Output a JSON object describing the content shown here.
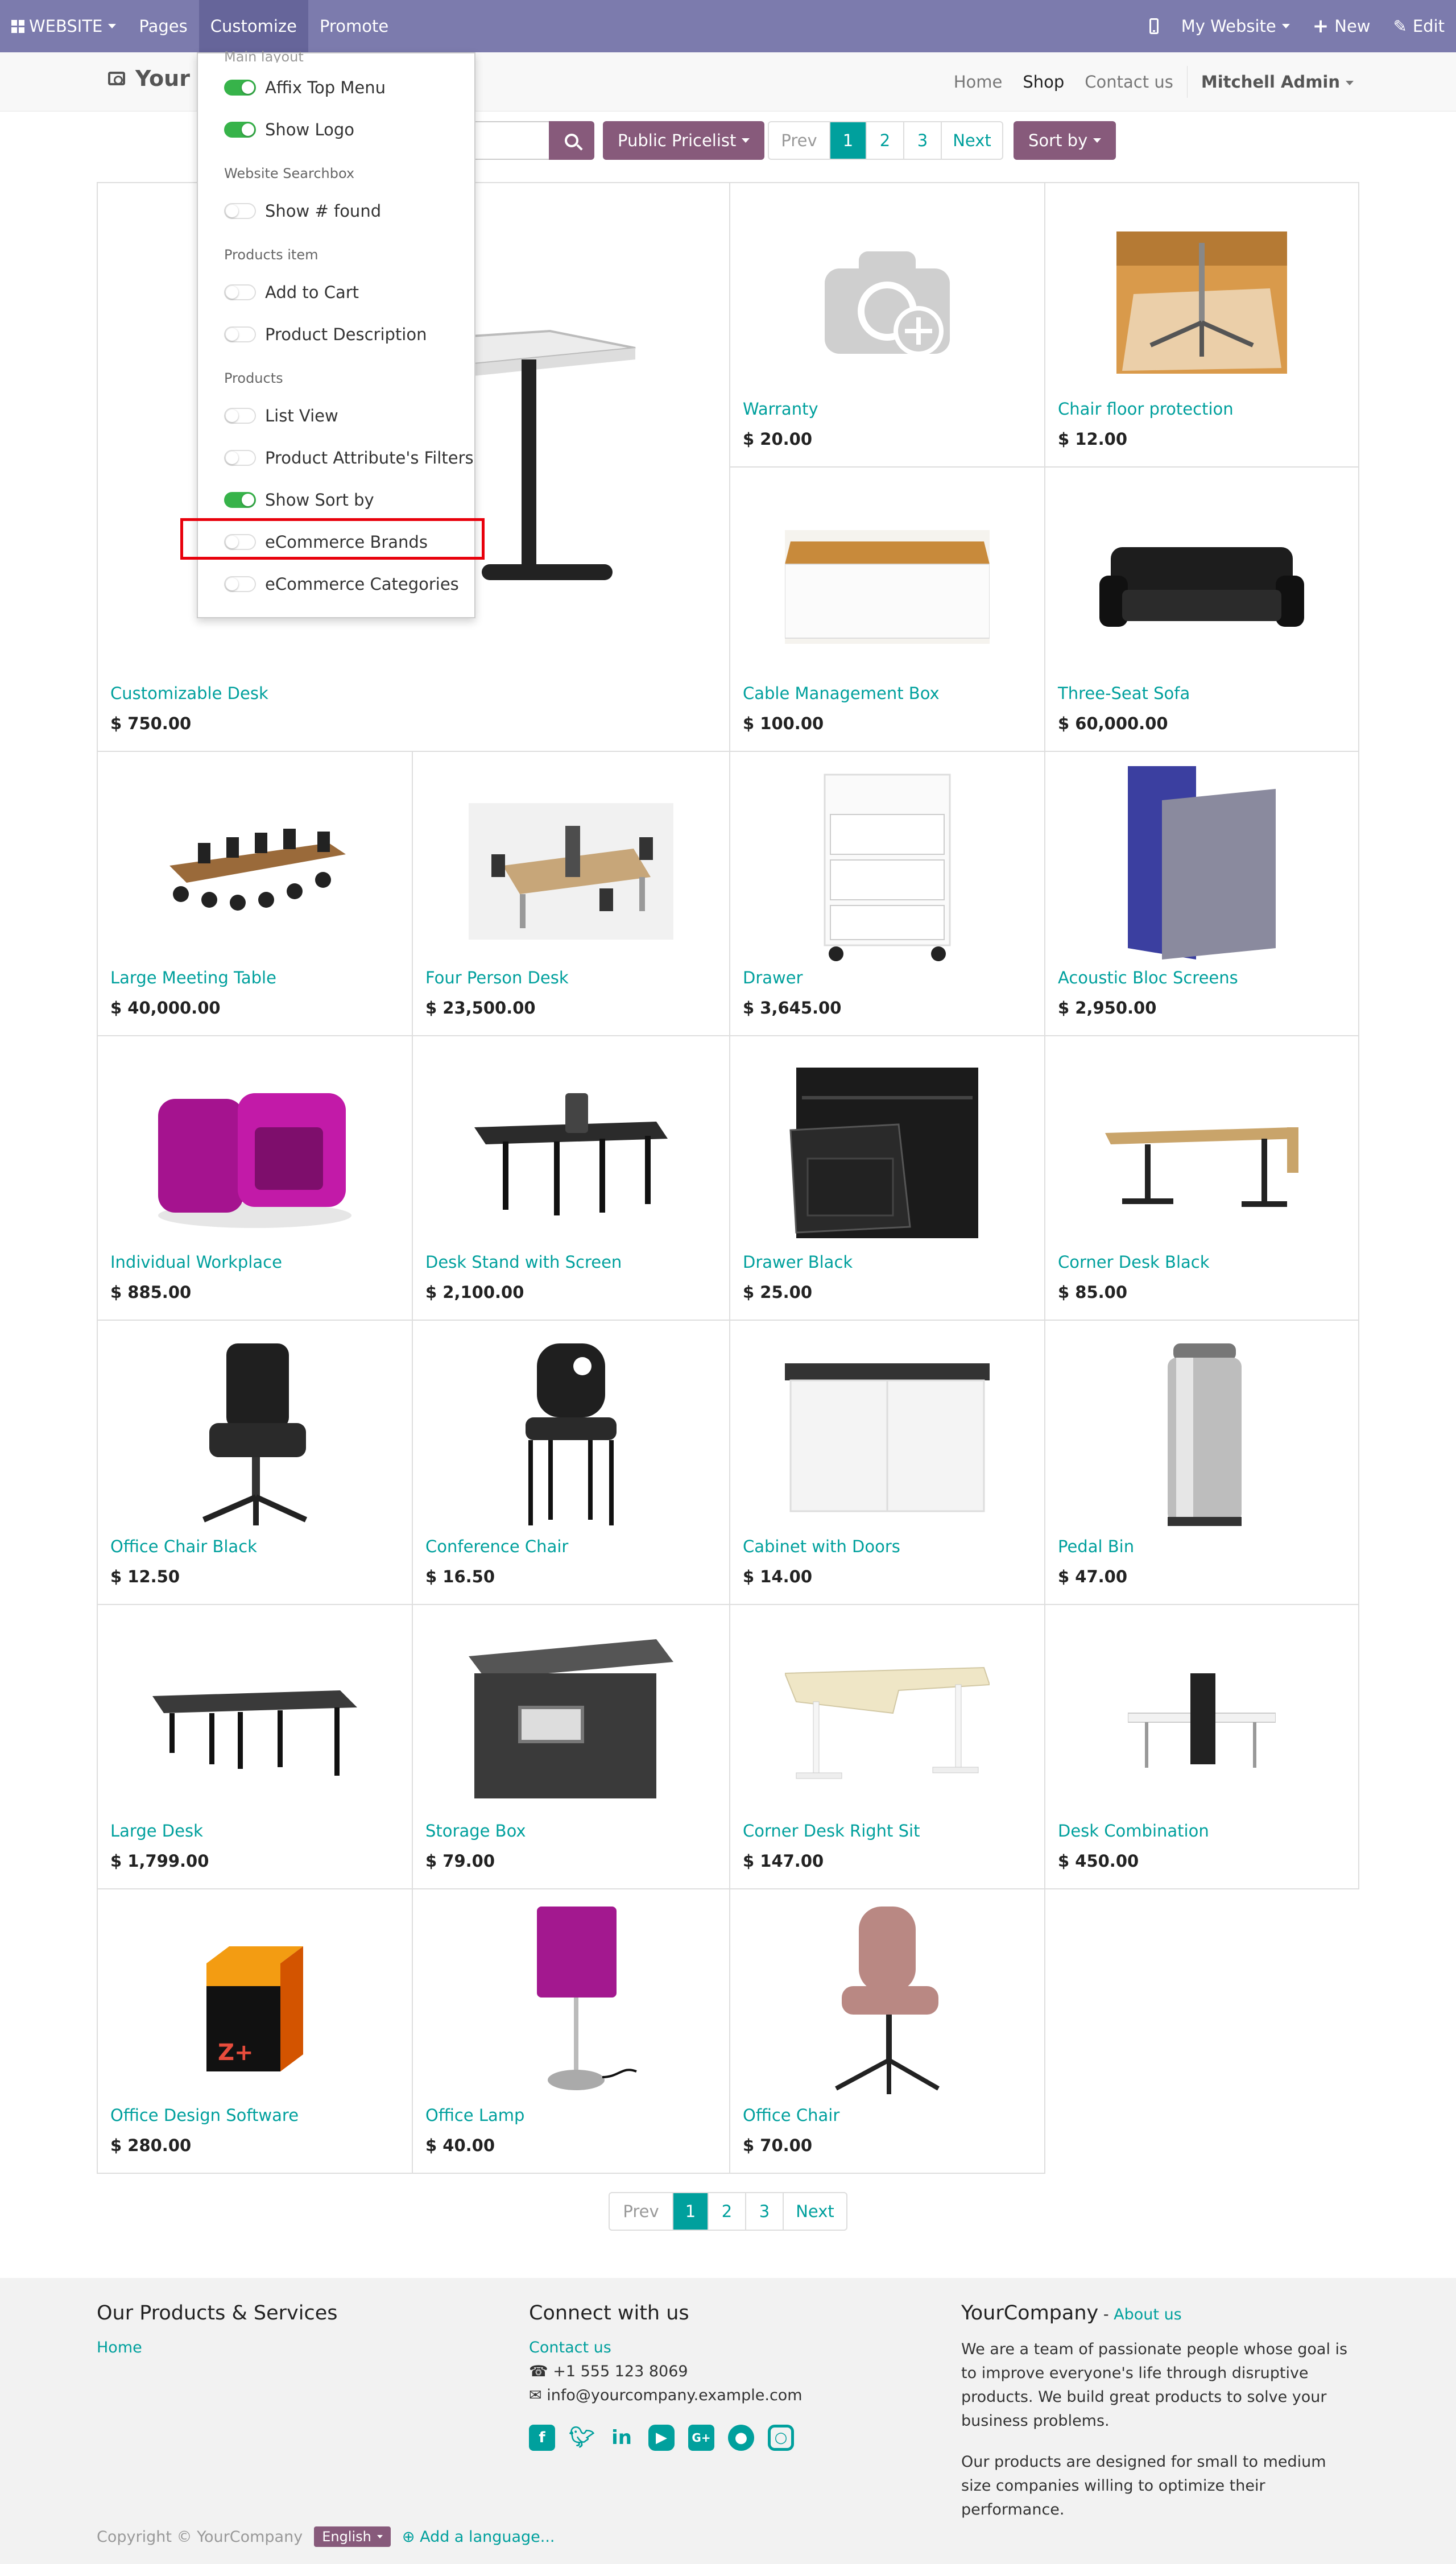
{
  "admin_bar": {
    "website": "WEBSITE",
    "pages": "Pages",
    "customize": "Customize",
    "promote": "Promote",
    "my_website": "My Website",
    "new": "New",
    "edit": "Edit"
  },
  "header": {
    "logo_text": "Your",
    "nav": [
      "Home",
      "Shop",
      "Contact us"
    ],
    "user": "Mitchell Admin"
  },
  "toolbar": {
    "pricelist": "Public Pricelist",
    "pager": [
      "Prev",
      "1",
      "2",
      "3",
      "Next"
    ],
    "sort_by": "Sort by"
  },
  "customize_menu": {
    "section_main": "Main layout",
    "affix_top_menu": "Affix Top Menu",
    "show_logo": "Show Logo",
    "section_search": "Website Searchbox",
    "show_found": "Show # found",
    "section_products_item": "Products item",
    "add_to_cart": "Add to Cart",
    "product_description": "Product Description",
    "section_products": "Products",
    "list_view": "List View",
    "attribute_filters": "Product Attribute's Filters",
    "show_sort_by": "Show Sort by",
    "ecommerce_brands": "eCommerce Brands",
    "ecommerce_categories": "eCommerce Categories",
    "toggles_on": [
      "Affix Top Menu",
      "Show Logo",
      "Show Sort by"
    ]
  },
  "products": [
    {
      "name": "Customizable Desk",
      "price": "$ 750.00"
    },
    {
      "name": "Warranty",
      "price": "$ 20.00"
    },
    {
      "name": "Chair floor protection",
      "price": "$ 12.00"
    },
    {
      "name": "Cable Management Box",
      "price": "$ 100.00"
    },
    {
      "name": "Three-Seat Sofa",
      "price": "$ 60,000.00"
    },
    {
      "name": "Large Meeting Table",
      "price": "$ 40,000.00"
    },
    {
      "name": "Four Person Desk",
      "price": "$ 23,500.00"
    },
    {
      "name": "Drawer",
      "price": "$ 3,645.00"
    },
    {
      "name": "Acoustic Bloc Screens",
      "price": "$ 2,950.00"
    },
    {
      "name": "Individual Workplace",
      "price": "$ 885.00"
    },
    {
      "name": "Desk Stand with Screen",
      "price": "$ 2,100.00"
    },
    {
      "name": "Drawer Black",
      "price": "$ 25.00"
    },
    {
      "name": "Corner Desk Black",
      "price": "$ 85.00"
    },
    {
      "name": "Office Chair Black",
      "price": "$ 12.50"
    },
    {
      "name": "Conference Chair",
      "price": "$ 16.50"
    },
    {
      "name": "Cabinet with Doors",
      "price": "$ 14.00"
    },
    {
      "name": "Pedal Bin",
      "price": "$ 47.00"
    },
    {
      "name": "Large Desk",
      "price": "$ 1,799.00"
    },
    {
      "name": "Storage Box",
      "price": "$ 79.00"
    },
    {
      "name": "Corner Desk Right Sit",
      "price": "$ 147.00"
    },
    {
      "name": "Desk Combination",
      "price": "$ 450.00"
    },
    {
      "name": "Office Design Software",
      "price": "$ 280.00"
    },
    {
      "name": "Office Lamp",
      "price": "$ 40.00"
    },
    {
      "name": "Office Chair",
      "price": "$ 70.00"
    }
  ],
  "bottom_pager": [
    "Prev",
    "1",
    "2",
    "3",
    "Next"
  ],
  "footer": {
    "col1_title": "Our Products & Services",
    "col1_home": "Home",
    "col2_title": "Connect with us",
    "contact_us": "Contact us",
    "phone": "+1 555 123 8069",
    "email": "info@yourcompany.example.com",
    "col3_title": "YourCompany",
    "col3_dash": " - ",
    "about_us": "About us",
    "about_p1": "We are a team of passionate people whose goal is to improve everyone's life through disruptive products. We build great products to solve your business problems.",
    "about_p2": "Our products are designed for small to medium size companies willing to optimize their performance.",
    "copyright": "Copyright © YourCompany",
    "language": "English",
    "add_language": "Add a language..."
  },
  "colors": {
    "admin_bar": "#7c7bad",
    "accent_teal": "#00a09d",
    "brand_purple": "#875a7b",
    "toggle_on": "#37b34a",
    "highlight_red": "#e8000b"
  }
}
